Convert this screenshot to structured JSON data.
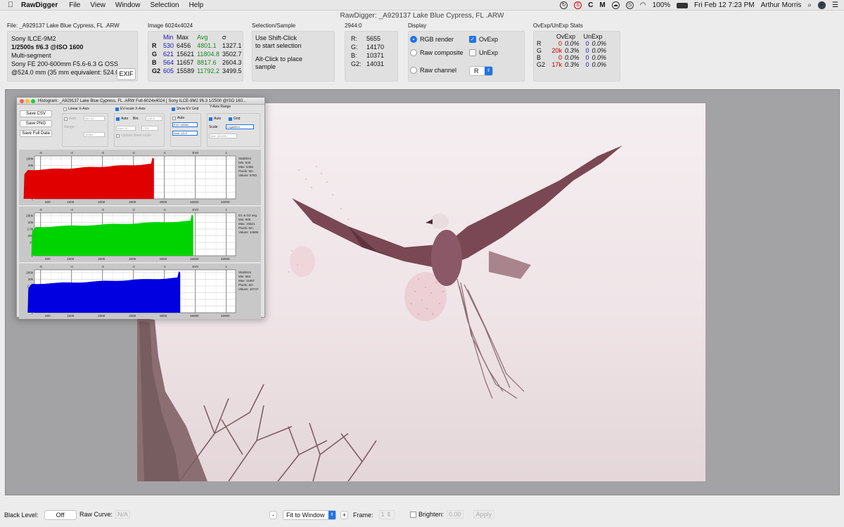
{
  "menubar": {
    "app": "RawDigger",
    "items": [
      "File",
      "View",
      "Window",
      "Selection",
      "Help"
    ],
    "battery": "100%",
    "datetime": "Fri Feb 12  7:23 PM",
    "user": "Arthur Morris"
  },
  "window_title": "RawDigger: _A929137  Lake Blue Cypress, FL .ARW",
  "file_panel": {
    "heading": "File: _A929137  Lake Blue Cypress, FL .ARW",
    "camera": "Sony ILCE-9M2",
    "exposure": "1/2500s f/6.3 @ISO 1600",
    "metering": "Multi-segment",
    "lens": "Sony FE 200-600mm F5.6-6.3 G OSS",
    "focal": "@524.0 mm (35 mm equivalent: 524.0",
    "exif_button": "EXIF"
  },
  "image_panel": {
    "heading": "Image 6024x4024",
    "cols": [
      "Min",
      "Max",
      "Avg",
      "σ"
    ],
    "rows": [
      {
        "ch": "R",
        "min": "530",
        "max": "6456",
        "avg": "4801.1",
        "sd": "1327.1"
      },
      {
        "ch": "G",
        "min": "621",
        "max": "15621",
        "avg": "11804.8",
        "sd": "3502.7"
      },
      {
        "ch": "B",
        "min": "564",
        "max": "11657",
        "avg": "8817.6",
        "sd": "2604.3"
      },
      {
        "ch": "G2",
        "min": "605",
        "max": "15589",
        "avg": "11792.2",
        "sd": "3499.5"
      }
    ]
  },
  "selection_panel": {
    "heading": "Selection/Sample",
    "line1": "Use Shift-Click",
    "line2": "to start selection",
    "line3": "Alt-Click to place",
    "line4": "sample"
  },
  "pixel_panel": {
    "heading": "2944:0",
    "rows": [
      {
        "k": "R:",
        "v": "5655"
      },
      {
        "k": "G:",
        "v": "14170"
      },
      {
        "k": "B:",
        "v": "10371"
      },
      {
        "k": "G2:",
        "v": "14031"
      }
    ]
  },
  "display_panel": {
    "heading": "Display",
    "rgb_render": "RGB render",
    "raw_composite": "Raw composite",
    "raw_channel": "Raw channel",
    "ovexp": "OvExp",
    "unexp": "UnExp",
    "channel_value": "R"
  },
  "ovexp_panel": {
    "heading": "OvExp/UnExp Stats",
    "col1": "OvExp",
    "col2": "UnExp",
    "rows": [
      {
        "ch": "R",
        "ov": "0",
        "ovp": "0.0%",
        "un": "0",
        "unp": "0.0%"
      },
      {
        "ch": "G",
        "ov": "20k",
        "ovp": "0.3%",
        "un": "0",
        "unp": "0.0%"
      },
      {
        "ch": "B",
        "ov": "0",
        "ovp": "0.0%",
        "un": "0",
        "unp": "0.0%"
      },
      {
        "ch": "G2",
        "ov": "17k",
        "ovp": "0.3%",
        "un": "0",
        "unp": "0.0%"
      }
    ]
  },
  "histogram": {
    "title": "Histogram: _A929137  Lake Blue Cypress, FL .ARW Full-6024x4024 [ Sony ILCE-9M2 f/6.3 1/2500 @ISO 160...",
    "save_csv": "Save CSV",
    "save_png": "Save PNG",
    "save_full": "Save Full Data",
    "linear_x": "Linear X-Axis",
    "auto": "Auto",
    "bin": "Bin:",
    "bin_value_linear": "Bin: 32",
    "range": "Range:",
    "range_value": "16384",
    "ev_scale": "EV-scale X-Axis",
    "bin_value_ev": "1/48 E",
    "from_value": "from: -8",
    "to_value": "7 EV",
    "update_linear": "Update linear scale",
    "show_ev_grid": "Show EV Grid",
    "ev0": "EV0: 16384",
    "grid": "Grid: 1/3 E",
    "y_axis_range": "Y-Axis Range",
    "grid_label": "Grid",
    "scale": "Scale",
    "scale_value": "Logarithm",
    "max_value": "Max: 640000",
    "ev_ticks": [
      "-5",
      "-4",
      "-3",
      "-2",
      "-1",
      "EV0",
      "1"
    ],
    "x_ticks": [
      "600",
      "1000",
      "2000",
      "4000",
      "8000",
      "16000",
      "32000"
    ],
    "y_ticks": [
      "200k",
      "20k",
      "2.0k",
      "200",
      "20",
      "2",
      "1"
    ],
    "panels": [
      {
        "label": "Statistics",
        "min": "Min: 530",
        "max": "Max: 6456",
        "pixels": "Pixels: 6m",
        "values": "Values: 5793",
        "color": "#e00000",
        "start_ev": -5.55,
        "end_ev": -1.34
      },
      {
        "label": "G1 & G2 avg",
        "min": "Min: 605",
        "max": "Max: 15621",
        "pixels": "Pixels: 6m",
        "values": "Values: 14566",
        "color": "#00d400",
        "start_ev": -5.3,
        "end_ev": -0.07
      },
      {
        "label": "Statistics",
        "min": "Min: 564",
        "max": "Max: 11657",
        "pixels": "Pixels: 6m",
        "values": "Values: 10747",
        "color": "#0000e0",
        "start_ev": -5.42,
        "end_ev": -0.49
      }
    ]
  },
  "bottom": {
    "black_level": "Black Level:",
    "black_level_value": "Off",
    "raw_curve": "Raw Curve:",
    "raw_curve_value": "N/A",
    "minus": "-",
    "zoom": "Fit to Window",
    "plus": "+",
    "frame": "Frame:",
    "frame_value": "1",
    "brighten": "Brighten:",
    "brighten_value": "0.00",
    "apply": "Apply"
  }
}
